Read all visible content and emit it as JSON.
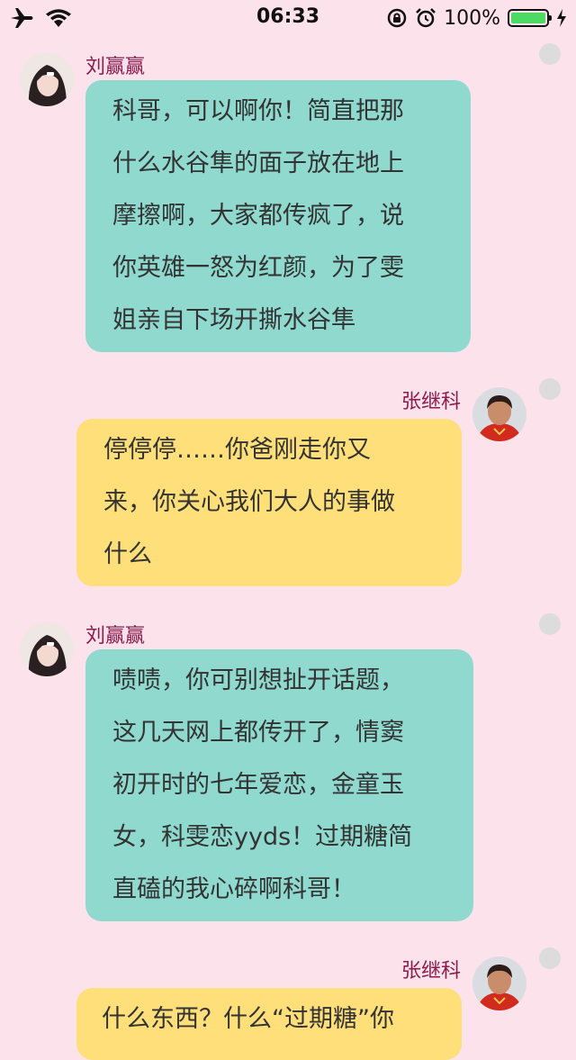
{
  "status": {
    "time": "06:33",
    "battery_percent": "100%",
    "battery_level": 1.0
  },
  "messages": [
    {
      "side": "left",
      "name": "刘赢赢",
      "lines": [
        "科哥，可以啊你！简直把那",
        "什么水谷隼的面子放在地上",
        "摩擦啊，大家都传疯了，说",
        "你英雄一怒为红颜，为了雯",
        "姐亲自下场开撕水谷隼"
      ]
    },
    {
      "side": "right",
      "name": "张继科",
      "lines": [
        "停停停……你爸刚走你又",
        "来，你关心我们大人的事做",
        "什么"
      ]
    },
    {
      "side": "left",
      "name": "刘赢赢",
      "lines": [
        "啧啧，你可别想扯开话题，",
        "这几天网上都传开了，情窦",
        "初开时的七年爱恋，金童玉",
        "女，科雯恋yyds！过期糖简",
        "直磕的我心碎啊科哥！"
      ]
    },
    {
      "side": "right",
      "name": "张继科",
      "lines": [
        "什么东西？什么“过期糖”你"
      ]
    }
  ]
}
